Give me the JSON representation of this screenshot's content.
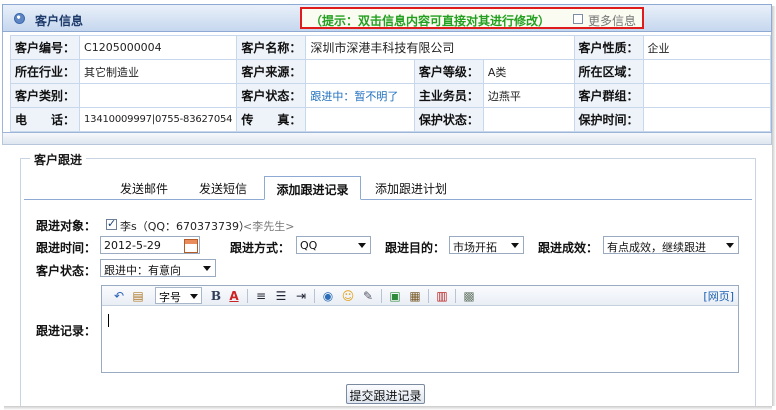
{
  "panel": {
    "title": "客户信息",
    "hint": "（提示：双击信息内容可直接对其进行修改）",
    "more_info_label": "更多信息"
  },
  "info": {
    "row1": [
      {
        "label": "客户编号：",
        "value": "C1205000004"
      },
      {
        "label": "客户名称：",
        "value": "深圳市深港丰科技有限公司"
      },
      {
        "label": "客户性质：",
        "value": "企业"
      }
    ],
    "row2": [
      {
        "label": "所在行业：",
        "value": "其它制造业"
      },
      {
        "label": "客户来源：",
        "value": ""
      },
      {
        "label": "客户等级：",
        "value": "A类"
      },
      {
        "label": "所在区域：",
        "value": ""
      }
    ],
    "row3": [
      {
        "label": "客户类别：",
        "value": ""
      },
      {
        "label": "客户状态：",
        "value": "跟进中：暂不明了"
      },
      {
        "label": "主业务员：",
        "value": "边燕平"
      },
      {
        "label": "客户群组：",
        "value": ""
      }
    ],
    "row4": [
      {
        "label": "电　　话：",
        "value": "13410009997|0755-83627054"
      },
      {
        "label": "传　　真：",
        "value": ""
      },
      {
        "label": "保护状态：",
        "value": ""
      },
      {
        "label": "保护时间：",
        "value": ""
      }
    ]
  },
  "followup": {
    "section_title": "客户跟进",
    "tabs": [
      "发送邮件",
      "发送短信",
      "添加跟进记录",
      "添加跟进计划"
    ],
    "active_tab_index": 2,
    "target_label": "跟进对象：",
    "target_name": "李s（QQ：670373739）",
    "target_alias": "<李先生>",
    "time_label": "跟进时间：",
    "time_value": "2012-5-29",
    "method_label": "跟进方式：",
    "method_value": "QQ",
    "purpose_label": "跟进目的：",
    "purpose_value": "市场开拓",
    "result_label": "跟进成效：",
    "result_value": "有点成效，继续跟进",
    "status_label": "客户状态：",
    "status_value": "跟进中：有意向",
    "record_label": "跟进记录：",
    "editor": {
      "font_size_label": "字号",
      "webpage_link": "[网页]"
    },
    "submit_label": "提交跟进记录"
  },
  "colors": {
    "hint_border": "#e01b1b",
    "hint_text": "#23a020",
    "link": "#1e6fbf",
    "header_text": "#1e3b6b"
  }
}
